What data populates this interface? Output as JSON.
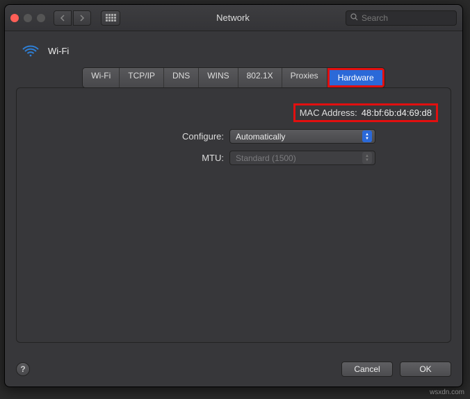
{
  "window": {
    "title": "Network",
    "search_placeholder": "Search"
  },
  "service": {
    "name": "Wi-Fi"
  },
  "tabs": [
    {
      "label": "Wi-Fi"
    },
    {
      "label": "TCP/IP"
    },
    {
      "label": "DNS"
    },
    {
      "label": "WINS"
    },
    {
      "label": "802.1X"
    },
    {
      "label": "Proxies"
    },
    {
      "label": "Hardware"
    }
  ],
  "hardware": {
    "mac_label": "MAC Address:",
    "mac_value": "48:bf:6b:d4:69:d8",
    "configure_label": "Configure:",
    "configure_value": "Automatically",
    "mtu_label": "MTU:",
    "mtu_value": "Standard (1500)"
  },
  "buttons": {
    "help": "?",
    "cancel": "Cancel",
    "ok": "OK"
  },
  "watermark": "wsxdn.com"
}
